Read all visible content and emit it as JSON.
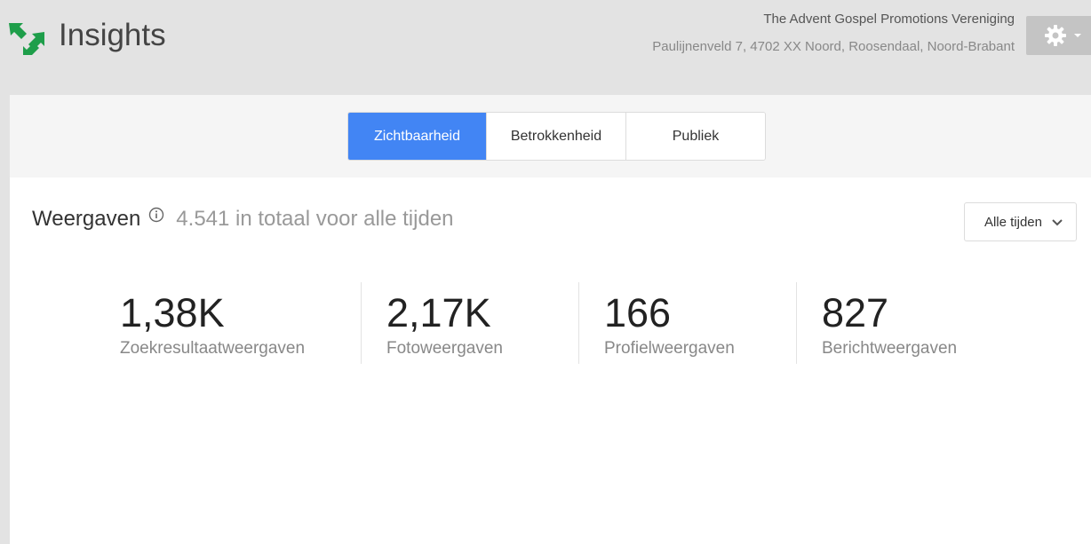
{
  "header": {
    "app_title": "Insights",
    "business_name": "The Advent Gospel Promotions Vereniging",
    "business_address": "Paulijnenveld 7, 4702 XX Noord, Roosendaal, Noord-Brabant",
    "logo_icon": "insights-logo-icon",
    "settings_icon": "gear-icon"
  },
  "tabs": [
    {
      "label": "Zichtbaarheid",
      "active": true
    },
    {
      "label": "Betrokkenheid",
      "active": false
    },
    {
      "label": "Publiek",
      "active": false
    }
  ],
  "views": {
    "title": "Weergaven",
    "total_text": "4.541 in totaal voor alle tijden",
    "info_icon": "info-icon"
  },
  "range_dropdown": {
    "selected": "Alle tijden",
    "icon": "chevron-down-icon"
  },
  "metrics": [
    {
      "value": "1,38K",
      "label": "Zoekresultaatweergaven"
    },
    {
      "value": "2,17K",
      "label": "Fotoweergaven"
    },
    {
      "value": "166",
      "label": "Profielweergaven"
    },
    {
      "value": "827",
      "label": "Berichtweergaven"
    }
  ],
  "colors": {
    "accent": "#4285f4",
    "logo_green": "#1e9e4a",
    "background": "#e3e3e3"
  }
}
